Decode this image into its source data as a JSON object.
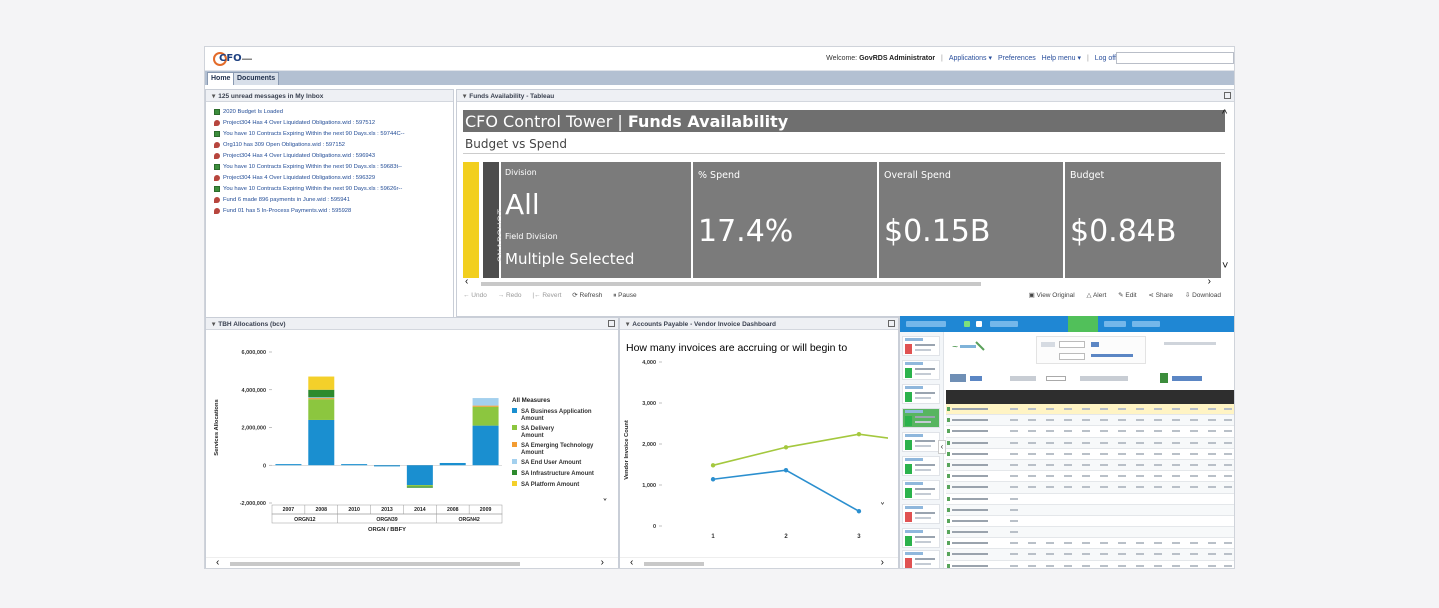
{
  "header": {
    "logo_text": "CFO",
    "welcome_label": "Welcome:",
    "user": "GovRDS Administrator",
    "applications": "Applications ▾",
    "preferences": "Preferences",
    "help": "Help menu ▾",
    "logoff": "Log off"
  },
  "tabs": [
    "Home",
    "Documents"
  ],
  "inbox": {
    "title": "125 unread messages in My Inbox",
    "messages": [
      {
        "icon": "excel",
        "text": "2020 Budget Is Loaded"
      },
      {
        "icon": "report",
        "text": "Project304 Has 4 Over Liquidated Obligations.wid : 597512"
      },
      {
        "icon": "excel",
        "text": "You have 10 Contracts Expiring Within the next 90 Days.xls : 59744C--"
      },
      {
        "icon": "report",
        "text": "Org110 has 309 Open Obligations.wid : 597152"
      },
      {
        "icon": "report",
        "text": "Project304 Has 4 Over Liquidated Obligations.wid : 596943"
      },
      {
        "icon": "excel",
        "text": "You have 10 Contracts Expiring Within the next 90 Days.xls : 59683t--"
      },
      {
        "icon": "report",
        "text": "Project304 Has 4 Over Liquidated Obligations.wid : 596329"
      },
      {
        "icon": "excel",
        "text": "You have 10 Contracts Expiring Within the next 90 Days.xls : 59626r--"
      },
      {
        "icon": "report",
        "text": "Fund 6 made 896 payments in June.wid : 595941"
      },
      {
        "icon": "report",
        "text": "Fund 01 has 5 In-Process Payments.wid : 595928"
      }
    ]
  },
  "tableau": {
    "panel_title": "Funds Availability - Tableau",
    "title_plain": "CFO Control Tower | ",
    "title_bold": "Funds Availability",
    "subtitle": "Budget vs Spend",
    "snapshot": "SNAPSHOT",
    "division_label": "Division",
    "division_value": "All",
    "field_division_label": "Field Division",
    "field_division_value": "Multiple Selected",
    "kpis": [
      {
        "label": "% Spend",
        "value": "17.4%"
      },
      {
        "label": "Overall Spend",
        "value": "$0.15B"
      },
      {
        "label": "Budget",
        "value": "$0.84B"
      }
    ],
    "toolbar_left": [
      "← Undo",
      "→ Redo",
      "|← Revert"
    ],
    "toolbar_mid": [
      "⟳ Refresh",
      "⏸ Pause"
    ],
    "toolbar_right": [
      "▣ View Original",
      "△ Alert",
      "✎ Edit",
      "⋖ Share",
      "⇩ Download"
    ]
  },
  "tbh": {
    "panel_title": "TBH Allocations (bcv)",
    "legend_title": "All Measures",
    "chart_data": {
      "type": "bar",
      "stacked": true,
      "ylabel": "Services Allocations",
      "xlabel": "ORGN / BBFY",
      "ylim": [
        -2000000,
        6000000
      ],
      "yticks": [
        -2000000,
        0,
        2000000,
        4000000,
        6000000
      ],
      "ytick_labels": [
        "-2,000,000",
        "0",
        "2,000,000",
        "4,000,000",
        "6,000,000"
      ],
      "categories": [
        "2007",
        "2008",
        "2010",
        "2013",
        "2014",
        "2008",
        "2009"
      ],
      "groups": [
        {
          "name": "ORGN12",
          "span": 2
        },
        {
          "name": "ORGN39",
          "span": 3
        },
        {
          "name": "ORGN42",
          "span": 2
        }
      ],
      "series": [
        {
          "name": "SA Business Application Amount",
          "color": "#1a8fd0",
          "values": [
            60000,
            2400000,
            60000,
            -60000,
            -1050000,
            120000,
            2100000
          ]
        },
        {
          "name": "SA Delivery Amount",
          "color": "#8cc63f",
          "values": [
            0,
            1100000,
            0,
            0,
            -80000,
            0,
            1000000
          ]
        },
        {
          "name": "SA Emerging Technology Amount",
          "color": "#f39c32",
          "values": [
            0,
            60000,
            0,
            0,
            0,
            0,
            60000
          ]
        },
        {
          "name": "SA End User Amount",
          "color": "#a3d0ee",
          "values": [
            0,
            40000,
            0,
            0,
            0,
            0,
            400000
          ]
        },
        {
          "name": "SA Infrastructure Amount",
          "color": "#2d8a2d",
          "values": [
            0,
            400000,
            0,
            0,
            -60000,
            0,
            0
          ]
        },
        {
          "name": "SA Platform Amount",
          "color": "#f4d02a",
          "values": [
            0,
            700000,
            0,
            0,
            0,
            0,
            0
          ]
        }
      ]
    }
  },
  "ap": {
    "panel_title": "Accounts Payable - Vendor Invoice Dashboard",
    "question": "How many invoices are accruing or will begin to",
    "chart_data": {
      "type": "line",
      "ylabel": "Vendor Invoice Count",
      "ylim": [
        0,
        4000
      ],
      "yticks": [
        0,
        1000,
        2000,
        3000,
        4000
      ],
      "ytick_labels": [
        "0",
        "1,000",
        "2,000",
        "3,000",
        "4,000"
      ],
      "x": [
        1,
        2,
        3
      ],
      "xtick_labels": [
        "1",
        "2",
        "3"
      ],
      "xlim": [
        0.3,
        3.7
      ],
      "series": [
        {
          "color": "#a4c83e",
          "values": [
            1480,
            1920,
            2240,
            2000
          ]
        },
        {
          "color": "#2b8fcf",
          "values": [
            1140,
            1360,
            360
          ]
        }
      ]
    }
  },
  "colors": {
    "tile_gray": "#7b7b7b",
    "title_gray": "#6f6f6f",
    "snapshot_yellow": "#f2cf1e",
    "tab_bar": "#b3c0d2",
    "link_blue": "#224c96",
    "spreadsheet_blue": "#1f87d4"
  }
}
